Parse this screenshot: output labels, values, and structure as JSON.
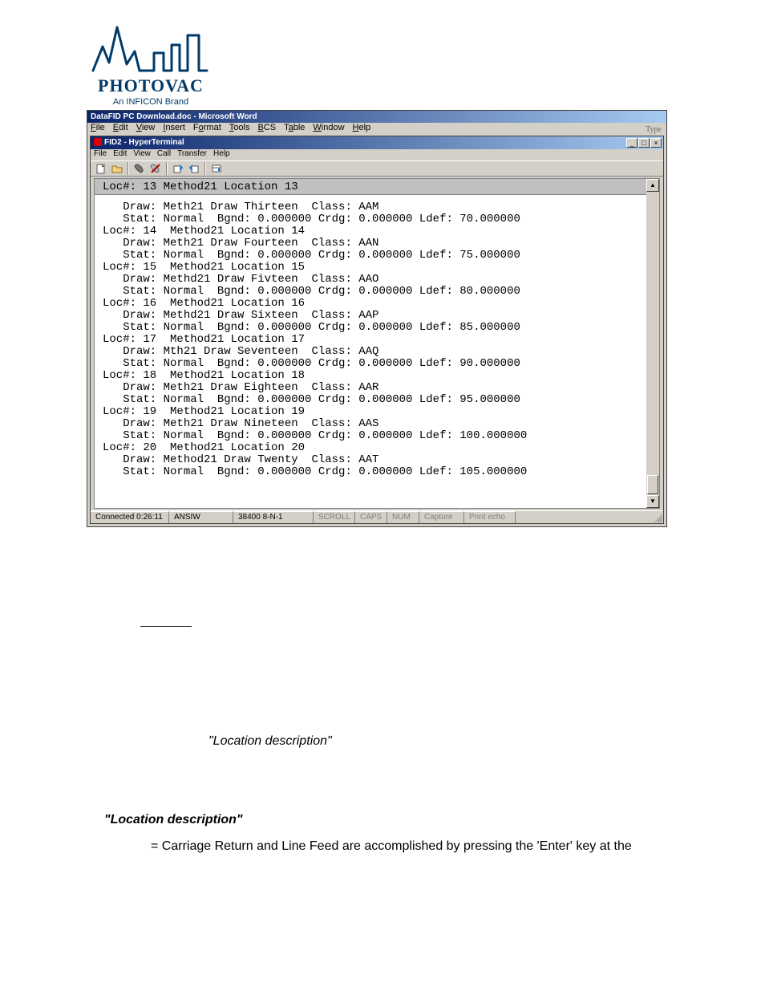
{
  "logo": {
    "wordmark": "PHOTOVAC",
    "tagline": "An INFICON Brand"
  },
  "word": {
    "title": "DataFID PC Download.doc - Microsoft Word",
    "menus": [
      "File",
      "Edit",
      "View",
      "Insert",
      "Format",
      "Tools",
      "BCS",
      "Table",
      "Window",
      "Help"
    ],
    "right_label": "Type"
  },
  "ht": {
    "title": "FID2 - HyperTerminal",
    "menus": [
      "File",
      "Edit",
      "View",
      "Call",
      "Transfer",
      "Help"
    ],
    "current_line": "Loc#: 13  Method21 Location 13",
    "status": {
      "connected": "Connected 0:26:11",
      "emu": "ANSIW",
      "port": "38400 8-N-1",
      "scroll": "SCROLL",
      "caps": "CAPS",
      "num": "NUM",
      "capture": "Capture",
      "print": "Print echo"
    },
    "log": "   Draw: Meth21 Draw Thirteen  Class: AAM\n   Stat: Normal  Bgnd: 0.000000 Crdg: 0.000000 Ldef: 70.000000\nLoc#: 14  Method21 Location 14\n   Draw: Meth21 Draw Fourteen  Class: AAN\n   Stat: Normal  Bgnd: 0.000000 Crdg: 0.000000 Ldef: 75.000000\nLoc#: 15  Method21 Location 15\n   Draw: Methd21 Draw Fivteen  Class: AAO\n   Stat: Normal  Bgnd: 0.000000 Crdg: 0.000000 Ldef: 80.000000\nLoc#: 16  Method21 Location 16\n   Draw: Methd21 Draw Sixteen  Class: AAP\n   Stat: Normal  Bgnd: 0.000000 Crdg: 0.000000 Ldef: 85.000000\nLoc#: 17  Method21 Location 17\n   Draw: Mth21 Draw Seventeen  Class: AAQ\n   Stat: Normal  Bgnd: 0.000000 Crdg: 0.000000 Ldef: 90.000000\nLoc#: 18  Method21 Location 18\n   Draw: Meth21 Draw Eighteen  Class: AAR\n   Stat: Normal  Bgnd: 0.000000 Crdg: 0.000000 Ldef: 95.000000\nLoc#: 19  Method21 Location 19\n   Draw: Meth21 Draw Nineteen  Class: AAS\n   Stat: Normal  Bgnd: 0.000000 Crdg: 0.000000 Ldef: 100.000000\nLoc#: 20  Method21 Location 20\n   Draw: Method21 Draw Twenty  Class: AAT\n   Stat: Normal  Bgnd: 0.000000 Crdg: 0.000000 Ldef: 105.000000"
  },
  "body": {
    "locdesc1": "\"Location description\"",
    "locdesc2": "\"Location description\"",
    "explain": "= Carriage Return and Line Feed are accomplished by pressing the 'Enter' key at the"
  },
  "chart_data": {
    "type": "table",
    "title": "HyperTerminal log — Method21 locations",
    "columns": [
      "Loc#",
      "Location",
      "Draw",
      "Class",
      "Stat",
      "Bgnd",
      "Crdg",
      "Ldef"
    ],
    "rows": [
      [
        13,
        "Method21 Location 13",
        "Meth21 Draw Thirteen",
        "AAM",
        "Normal",
        0.0,
        0.0,
        70.0
      ],
      [
        14,
        "Method21 Location 14",
        "Meth21 Draw Fourteen",
        "AAN",
        "Normal",
        0.0,
        0.0,
        75.0
      ],
      [
        15,
        "Method21 Location 15",
        "Methd21 Draw Fivteen",
        "AAO",
        "Normal",
        0.0,
        0.0,
        80.0
      ],
      [
        16,
        "Method21 Location 16",
        "Methd21 Draw Sixteen",
        "AAP",
        "Normal",
        0.0,
        0.0,
        85.0
      ],
      [
        17,
        "Method21 Location 17",
        "Mth21 Draw Seventeen",
        "AAQ",
        "Normal",
        0.0,
        0.0,
        90.0
      ],
      [
        18,
        "Method21 Location 18",
        "Meth21 Draw Eighteen",
        "AAR",
        "Normal",
        0.0,
        0.0,
        95.0
      ],
      [
        19,
        "Method21 Location 19",
        "Meth21 Draw Nineteen",
        "AAS",
        "Normal",
        0.0,
        0.0,
        100.0
      ],
      [
        20,
        "Method21 Location 20",
        "Method21 Draw Twenty",
        "AAT",
        "Normal",
        0.0,
        0.0,
        105.0
      ]
    ]
  }
}
